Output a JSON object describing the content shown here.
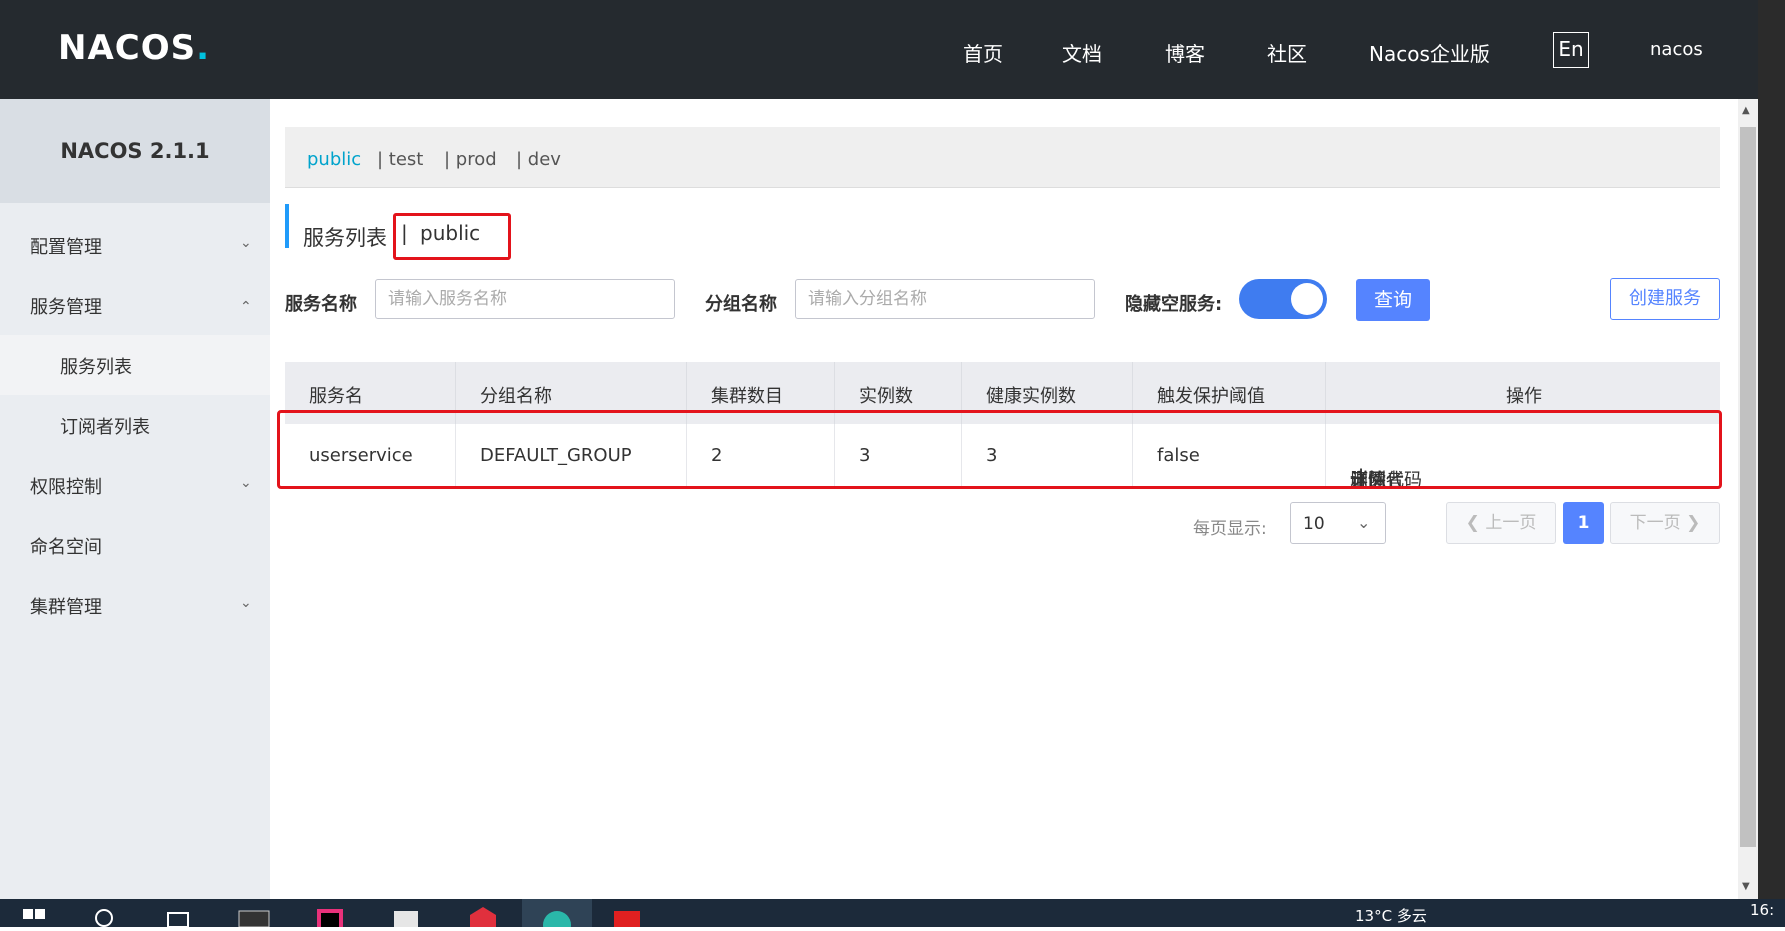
{
  "header": {
    "logo_text": "NACOS",
    "logo_dot": ".",
    "nav": [
      "首页",
      "文档",
      "博客",
      "社区",
      "Nacos企业版"
    ],
    "lang": "En",
    "user": "nacos"
  },
  "sidebar": {
    "title": "NACOS 2.1.1",
    "items": [
      {
        "label": "配置管理"
      },
      {
        "label": "服务管理"
      },
      {
        "label": "服务列表"
      },
      {
        "label": "订阅者列表"
      },
      {
        "label": "权限控制"
      },
      {
        "label": "命名空间"
      },
      {
        "label": "集群管理"
      }
    ]
  },
  "namespaces": {
    "items": [
      "public",
      "| test",
      "| prod",
      "| dev"
    ]
  },
  "page": {
    "title": "服务列表",
    "sep": "|",
    "namespace": "public"
  },
  "filters": {
    "service_label": "服务名称",
    "service_placeholder": "请输入服务名称",
    "group_label": "分组名称",
    "group_placeholder": "请输入分组名称",
    "hide_empty_label": "隐藏空服务:",
    "query_button": "查询",
    "create_button": "创建服务"
  },
  "table": {
    "headers": [
      "服务名",
      "分组名称",
      "集群数目",
      "实例数",
      "健康实例数",
      "触发保护阈值",
      "操作"
    ],
    "rows": [
      {
        "name": "userservice",
        "group": "DEFAULT_GROUP",
        "clusters": "2",
        "instances": "3",
        "healthy": "3",
        "threshold": "false",
        "ops": [
          "详情",
          "示例代码",
          "订阅者",
          "删除"
        ]
      }
    ]
  },
  "pager": {
    "page_size_label": "每页显示:",
    "page_size": "10",
    "prev": "上一页",
    "current": "1",
    "next": "下一页"
  },
  "taskbar": {
    "weather": "13°C 多云",
    "time": "16:"
  }
}
